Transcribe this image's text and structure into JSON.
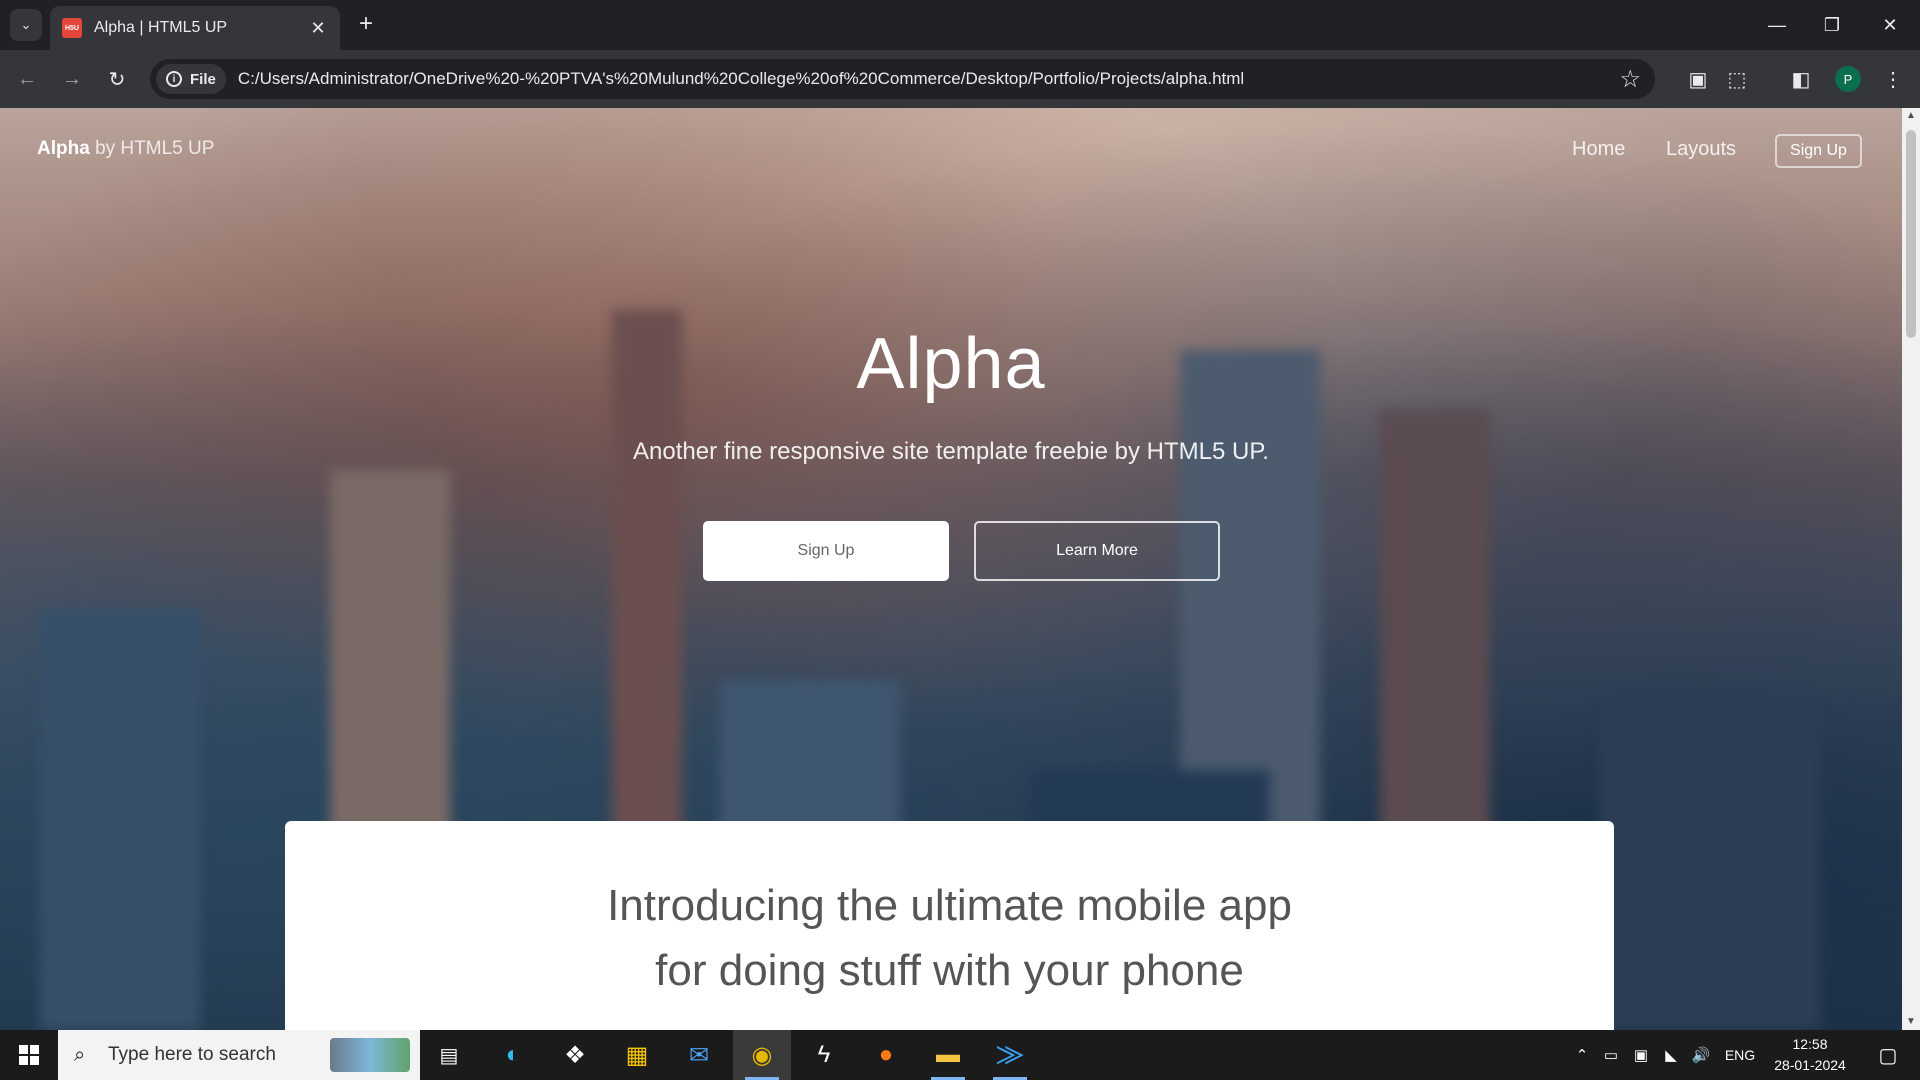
{
  "browser": {
    "tab_title": "Alpha | HTML5 UP",
    "favicon_text": "H5U",
    "site_chip_label": "File",
    "url": "C:/Users/Administrator/OneDrive%20-%20PTVA's%20Mulund%20College%20of%20Commerce/Desktop/Portfolio/Projects/alpha.html",
    "profile_initial": "P"
  },
  "site": {
    "logo_name": "Alpha",
    "logo_by": "by HTML5 UP",
    "nav": {
      "home": "Home",
      "layouts": "Layouts",
      "signup": "Sign Up"
    },
    "hero": {
      "title": "Alpha",
      "subtitle": "Another fine responsive site template freebie by HTML5 UP.",
      "btn_primary": "Sign Up",
      "btn_secondary": "Learn More"
    },
    "panel": {
      "heading_line1": "Introducing the ultimate mobile app",
      "heading_line2": "for doing stuff with your phone"
    }
  },
  "taskbar": {
    "search_placeholder": "Type here to search",
    "language": "ENG",
    "time": "12:58",
    "date": "28-01-2024"
  },
  "colors": {
    "chrome_dark": "#202124",
    "chrome_toolbar": "#35363a",
    "favicon_red": "#e4473a",
    "profile_green": "#0b6e4f",
    "taskbar": "#1b1b1b"
  }
}
